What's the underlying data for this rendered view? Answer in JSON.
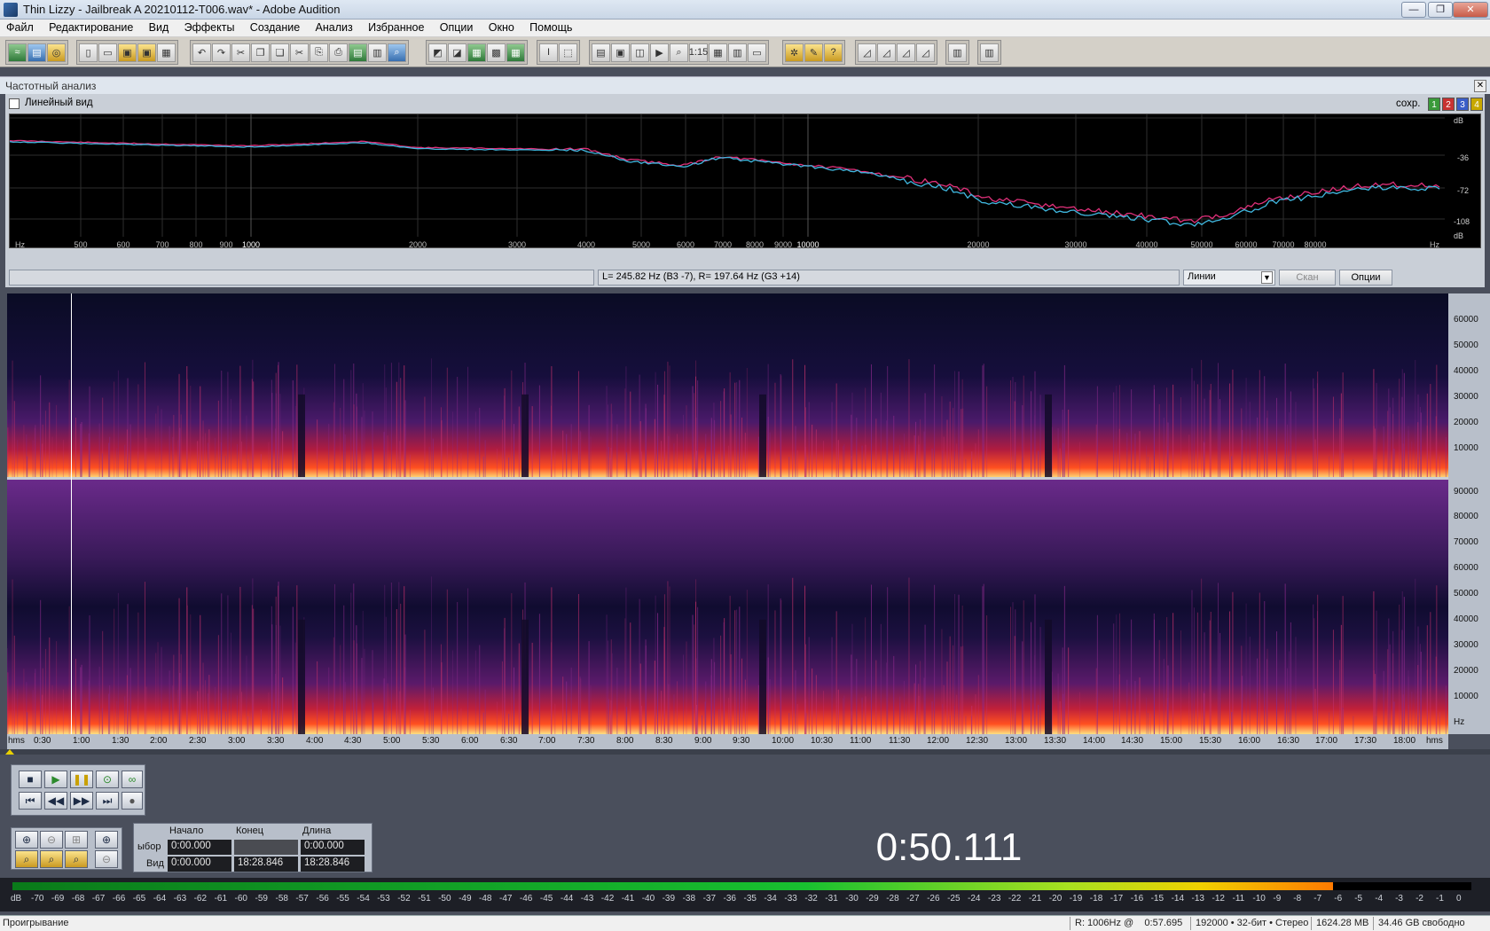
{
  "window": {
    "title": "Thin Lizzy - Jailbreak  A 20210112-T006.wav* - Adobe Audition",
    "min_label": "—",
    "max_label": "❐",
    "close_label": "✕"
  },
  "menu": [
    "Файл",
    "Редактирование",
    "Вид",
    "Эффекты",
    "Создание",
    "Анализ",
    "Избранное",
    "Опции",
    "Окно",
    "Помощь"
  ],
  "freq_panel": {
    "title": "Частотный анализ",
    "linear_view_label": "Линейный вид",
    "save_label": "сохр.",
    "save_slots": [
      {
        "label": "1",
        "color": "#3a9a3a"
      },
      {
        "label": "2",
        "color": "#c83232"
      },
      {
        "label": "3",
        "color": "#3a5ec8"
      },
      {
        "label": "4",
        "color": "#c8a800"
      }
    ],
    "db_labels": [
      "dB",
      "-36",
      "-72",
      "-108",
      "dB"
    ],
    "hz_ticks": [
      "Hz",
      "500",
      "600",
      "700",
      "800",
      "900",
      "1000",
      "2000",
      "3000",
      "4000",
      "5000",
      "6000",
      "7000",
      "8000",
      "9000",
      "10000",
      "20000",
      "30000",
      "40000",
      "50000",
      "60000",
      "70000",
      "80000",
      "Hz"
    ],
    "status_text": "L= 245.82 Hz (B3 -7), R= 197.64 Hz (G3 +14)",
    "mode_select": "Линии",
    "scan_button": "Скан",
    "options_button": "Опции"
  },
  "spectrogram": {
    "top_scale": [
      "60000",
      "50000",
      "40000",
      "30000",
      "20000",
      "10000"
    ],
    "bottom_scale": [
      "90000",
      "80000",
      "70000",
      "60000",
      "50000",
      "40000",
      "30000",
      "20000",
      "10000",
      "Hz"
    ],
    "time_ticks": [
      "hms",
      "0:30",
      "1:00",
      "1:30",
      "2:00",
      "2:30",
      "3:00",
      "3:30",
      "4:00",
      "4:30",
      "5:00",
      "5:30",
      "6:00",
      "6:30",
      "7:00",
      "7:30",
      "8:00",
      "8:30",
      "9:00",
      "9:30",
      "10:00",
      "10:30",
      "11:00",
      "11:30",
      "12:00",
      "12:30",
      "13:00",
      "13:30",
      "14:00",
      "14:30",
      "15:00",
      "15:30",
      "16:00",
      "16:30",
      "17:00",
      "17:30",
      "18:00",
      "hms"
    ]
  },
  "selection": {
    "headers": [
      "Начало",
      "Конец",
      "Длина"
    ],
    "row_sel_label": "ыбор",
    "row_view_label": "Вид",
    "sel_start": "0:00.000",
    "sel_end": "",
    "sel_length": "0:00.000",
    "view_start": "0:00.000",
    "view_end": "18:28.846",
    "view_length": "18:28.846"
  },
  "current_time": "0:50.111",
  "meter_scale": [
    "dB",
    "-70",
    "-69",
    "-68",
    "-67",
    "-66",
    "-65",
    "-64",
    "-63",
    "-62",
    "-61",
    "-60",
    "-59",
    "-58",
    "-57",
    "-56",
    "-55",
    "-54",
    "-53",
    "-52",
    "-51",
    "-50",
    "-49",
    "-48",
    "-47",
    "-46",
    "-45",
    "-44",
    "-43",
    "-42",
    "-41",
    "-40",
    "-39",
    "-38",
    "-37",
    "-36",
    "-35",
    "-34",
    "-33",
    "-32",
    "-31",
    "-30",
    "-29",
    "-28",
    "-27",
    "-26",
    "-25",
    "-24",
    "-23",
    "-22",
    "-21",
    "-20",
    "-19",
    "-18",
    "-17",
    "-16",
    "-15",
    "-14",
    "-13",
    "-12",
    "-11",
    "-10",
    "-9",
    "-8",
    "-7",
    "-6",
    "-5",
    "-4",
    "-3",
    "-2",
    "-1",
    "0"
  ],
  "meter_level": 0.905,
  "status": {
    "mode": "Проигрывание",
    "cursor": "R: 1006Hz @    0:57.695",
    "format": "192000 • 32-бит • Стерео",
    "file_size": "1624.28 MB",
    "free_space": "34.46 GB свободно"
  },
  "colors": {
    "curve_left": "#e0307a",
    "curve_right": "#40b8e0"
  }
}
